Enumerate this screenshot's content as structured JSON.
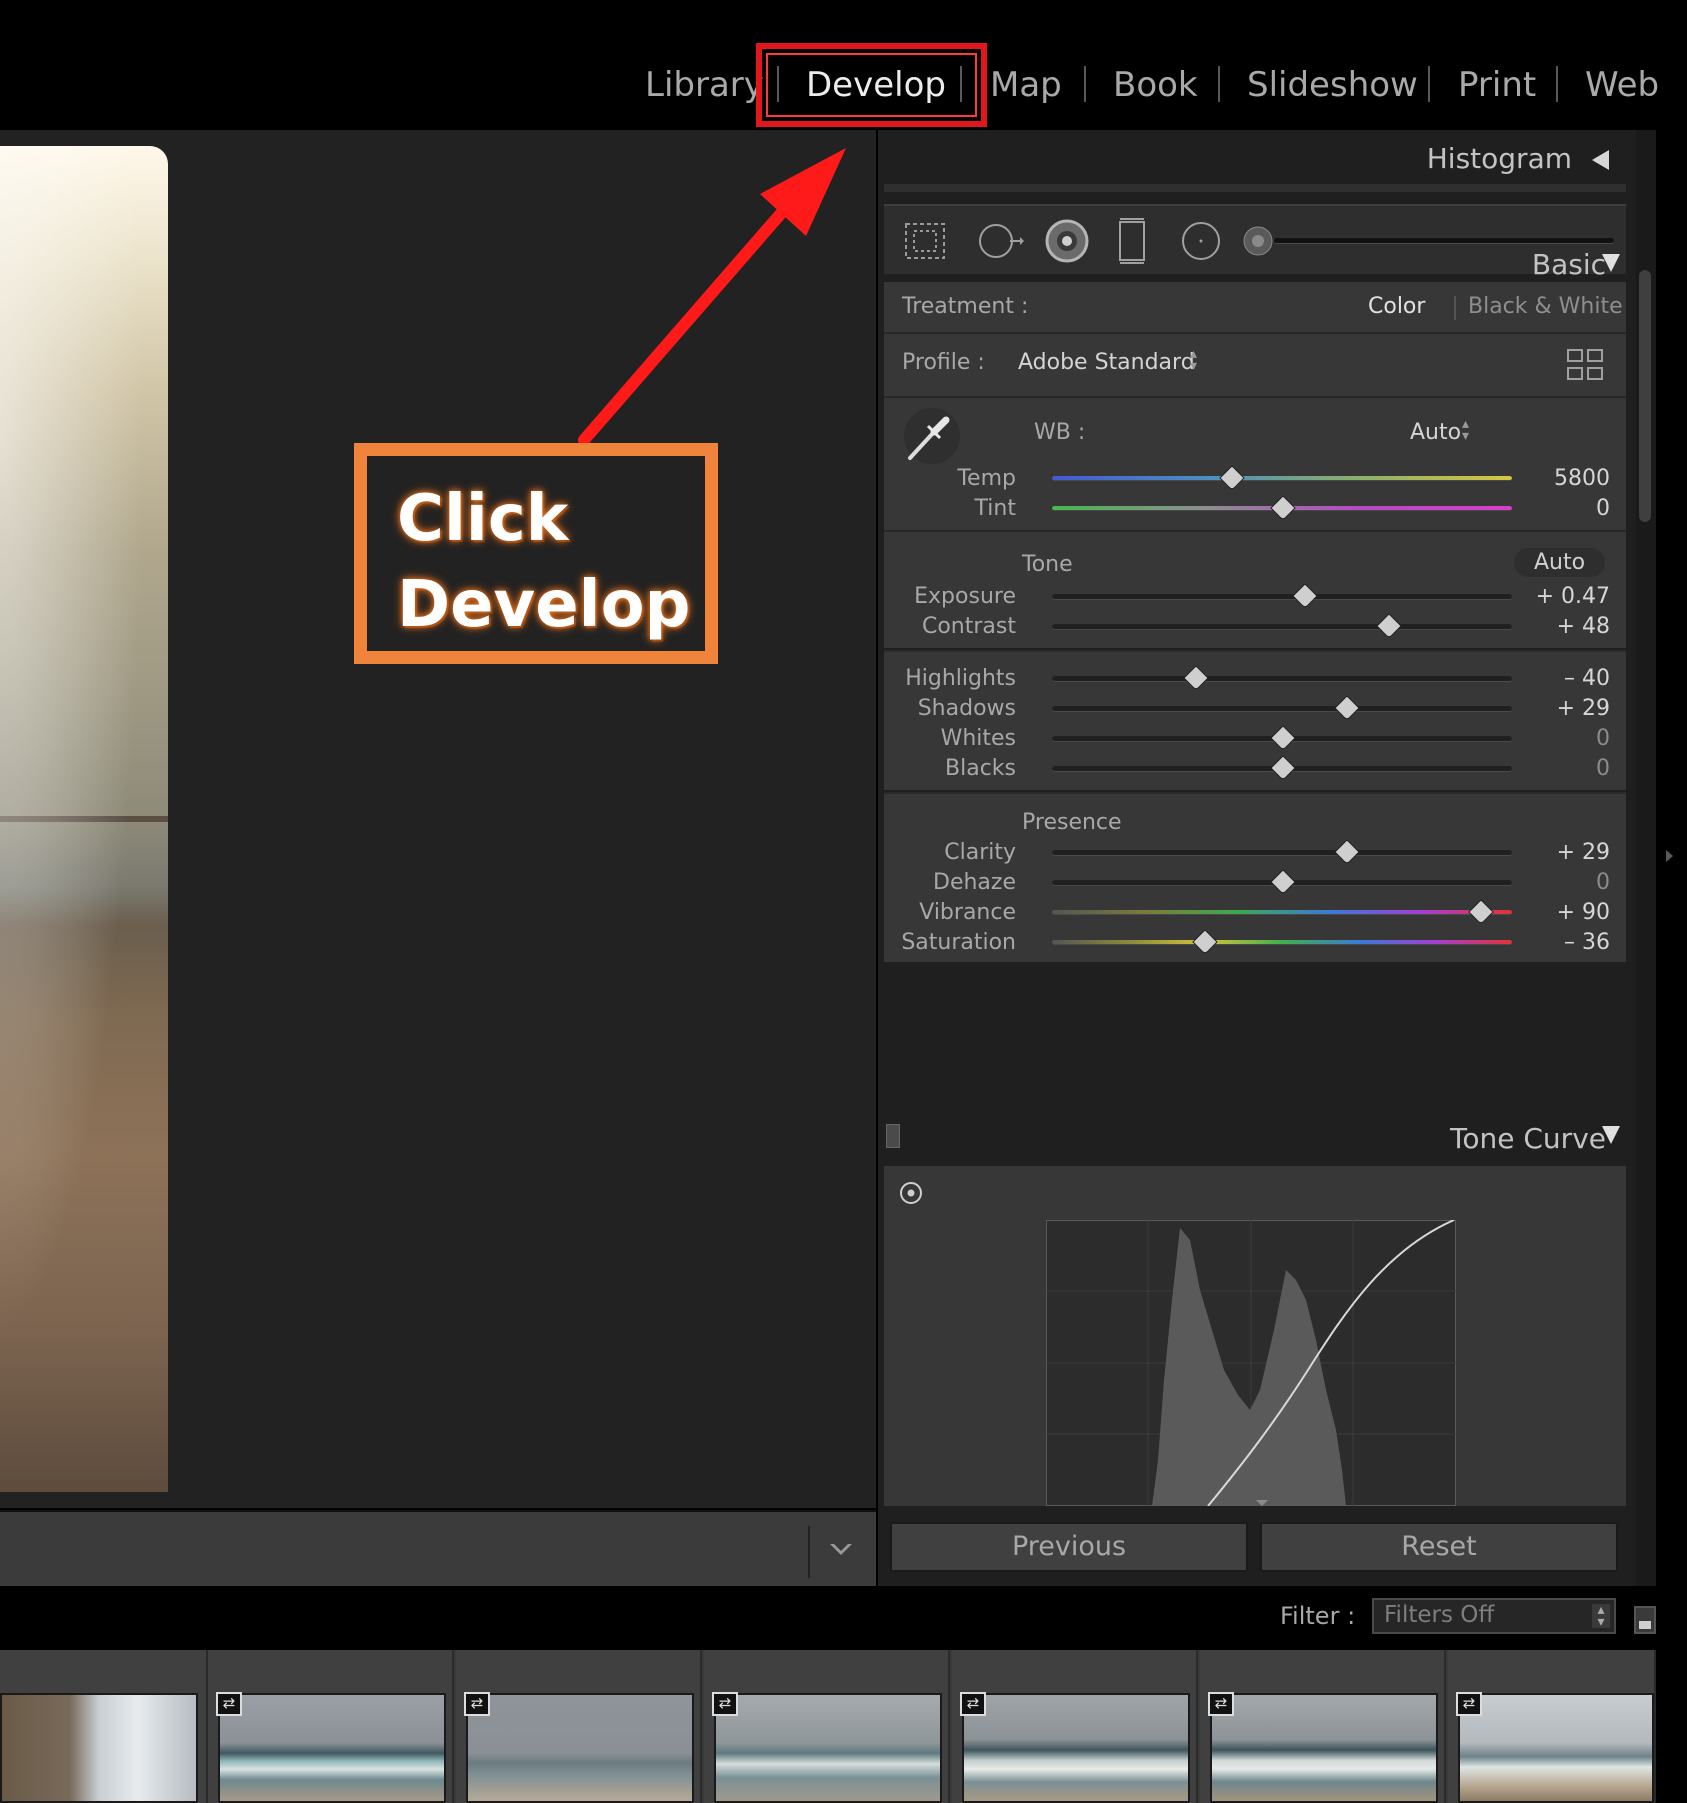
{
  "modules": {
    "library": "Library",
    "develop": "Develop",
    "map": "Map",
    "book": "Book",
    "slideshow": "Slideshow",
    "print": "Print",
    "web": "Web"
  },
  "annotation": {
    "line1": "Click",
    "line2": "Develop",
    "arrow_color": "#ff1a1a",
    "box_color": "#f0843a"
  },
  "histogram": {
    "title": "Histogram"
  },
  "basic": {
    "title": "Basic",
    "treatment_label": "Treatment :",
    "treatment_color": "Color",
    "treatment_bw": "Black & White",
    "profile_label": "Profile :",
    "profile_value": "Adobe Standard",
    "wb_label": "WB :",
    "wb_value": "Auto",
    "temp_label": "Temp",
    "temp_value": "5800",
    "tint_label": "Tint",
    "tint_value": "0",
    "tone_label": "Tone",
    "tone_auto": "Auto",
    "exposure_label": "Exposure",
    "exposure_value": "+ 0.47",
    "contrast_label": "Contrast",
    "contrast_value": "+ 48",
    "highlights_label": "Highlights",
    "highlights_value": "– 40",
    "shadows_label": "Shadows",
    "shadows_value": "+ 29",
    "whites_label": "Whites",
    "whites_value": "0",
    "blacks_label": "Blacks",
    "blacks_value": "0",
    "presence_label": "Presence",
    "clarity_label": "Clarity",
    "clarity_value": "+ 29",
    "dehaze_label": "Dehaze",
    "dehaze_value": "0",
    "vibrance_label": "Vibrance",
    "vibrance_value": "+ 90",
    "saturation_label": "Saturation",
    "saturation_value": "– 36"
  },
  "slider_positions": {
    "temp": 0.39,
    "tint": 0.5,
    "exposure": 0.547,
    "contrast": 0.73,
    "highlights": 0.31,
    "shadows": 0.64,
    "whites": 0.5,
    "blacks": 0.5,
    "clarity": 0.64,
    "dehaze": 0.5,
    "vibrance": 0.93,
    "saturation": 0.33
  },
  "tone_curve": {
    "title": "Tone Curve"
  },
  "buttons": {
    "previous": "Previous",
    "reset": "Reset"
  },
  "filter": {
    "label": "Filter :",
    "value": "Filters Off"
  },
  "colors": {
    "active_module": "#ececec",
    "inactive_module": "#a9a9a9",
    "highlight_frame": "#e0181e"
  }
}
